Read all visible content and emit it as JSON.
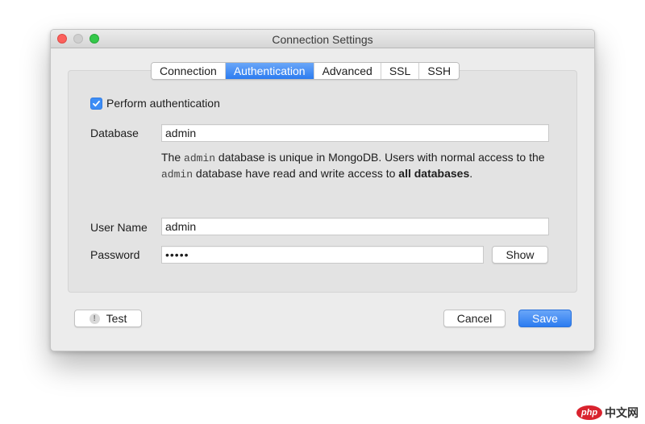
{
  "window": {
    "title": "Connection Settings"
  },
  "tabs": [
    {
      "label": "Connection"
    },
    {
      "label": "Authentication"
    },
    {
      "label": "Advanced"
    },
    {
      "label": "SSL"
    },
    {
      "label": "SSH"
    }
  ],
  "auth": {
    "perform_label": "Perform authentication",
    "perform_checked": true,
    "database_label": "Database",
    "database_value": "admin",
    "description": {
      "part1": "The ",
      "code1": "admin",
      "part2": " database is unique in MongoDB. Users with normal access to the ",
      "code2": "admin",
      "part3": " database have read and write access to ",
      "bold": "all databases",
      "part4": "."
    },
    "username_label": "User Name",
    "username_value": "admin",
    "password_label": "Password",
    "password_value": "•••••",
    "show_label": "Show"
  },
  "footer": {
    "test_label": "Test",
    "cancel_label": "Cancel",
    "save_label": "Save"
  },
  "watermark": {
    "logo_text": "php",
    "site_text": "中文网"
  },
  "colors": {
    "accent": "#2c7cf0",
    "close": "#fc605c",
    "maximize": "#34c84a"
  }
}
